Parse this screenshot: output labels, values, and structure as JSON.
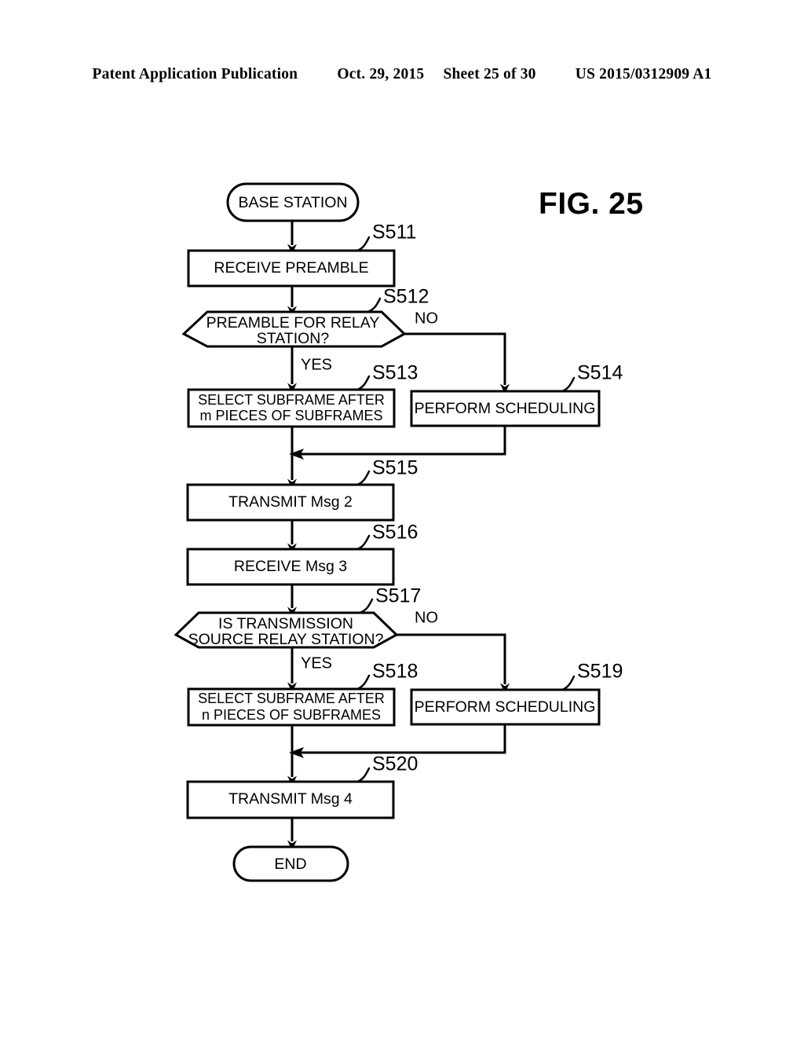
{
  "header": {
    "publication": "Patent Application Publication",
    "date": "Oct. 29, 2015",
    "sheet": "Sheet 25 of 30",
    "number": "US 2015/0312909 A1"
  },
  "figure": {
    "title": "FIG. 25"
  },
  "flowchart": {
    "start_node": "BASE STATION",
    "end_node": "END",
    "branch_yes": "YES",
    "branch_no": "NO",
    "nodes": [
      {
        "id": "s511",
        "step": "S511",
        "type": "process",
        "lines": [
          "RECEIVE PREAMBLE"
        ]
      },
      {
        "id": "s512",
        "step": "S512",
        "type": "decision",
        "lines": [
          "PREAMBLE FOR RELAY",
          "STATION?"
        ]
      },
      {
        "id": "s513",
        "step": "S513",
        "type": "process",
        "lines": [
          "SELECT SUBFRAME AFTER",
          "m PIECES OF SUBFRAMES"
        ]
      },
      {
        "id": "s514",
        "step": "S514",
        "type": "process",
        "lines": [
          "PERFORM SCHEDULING"
        ]
      },
      {
        "id": "s515",
        "step": "S515",
        "type": "process",
        "lines": [
          "TRANSMIT Msg 2"
        ]
      },
      {
        "id": "s516",
        "step": "S516",
        "type": "process",
        "lines": [
          "RECEIVE Msg 3"
        ]
      },
      {
        "id": "s517",
        "step": "S517",
        "type": "decision",
        "lines": [
          "IS TRANSMISSION",
          "SOURCE RELAY STATION?"
        ]
      },
      {
        "id": "s518",
        "step": "S518",
        "type": "process",
        "lines": [
          "SELECT SUBFRAME AFTER",
          "n PIECES OF SUBFRAMES"
        ]
      },
      {
        "id": "s519",
        "step": "S519",
        "type": "process",
        "lines": [
          "PERFORM SCHEDULING"
        ]
      },
      {
        "id": "s520",
        "step": "S520",
        "type": "process",
        "lines": [
          "TRANSMIT Msg 4"
        ]
      }
    ]
  },
  "colors": {
    "ink": "#000000",
    "page": "#ffffff"
  }
}
